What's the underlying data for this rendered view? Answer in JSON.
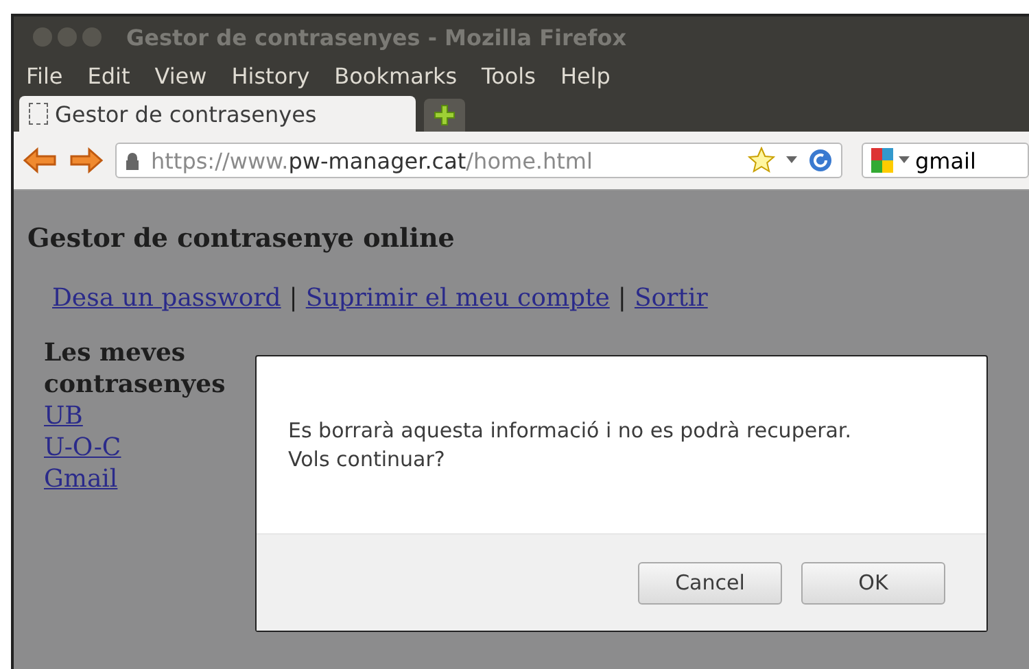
{
  "window": {
    "title": "Gestor de contrasenyes - Mozilla Firefox"
  },
  "menu": [
    "File",
    "Edit",
    "View",
    "History",
    "Bookmarks",
    "Tools",
    "Help"
  ],
  "tabs": [
    {
      "label": "Gestor de contrasenyes",
      "selected": true
    }
  ],
  "address": {
    "prefix": "https://www.",
    "host": "pw-manager.cat",
    "path": "/home.html"
  },
  "search": {
    "value": "gmail"
  },
  "page": {
    "heading": "Gestor de contrasenye online",
    "links": [
      "Desa un password",
      "Suprimir el meu compte",
      "Sortir"
    ],
    "separator": "|",
    "sidebar_title": "Les meves contrasenyes",
    "sidebar_links": [
      "UB",
      "U-O-C",
      "Gmail"
    ]
  },
  "dialog": {
    "message": "Es borrarà aquesta informació i no es podrà recuperar.",
    "question": "Vols continuar?",
    "buttons": [
      "Cancel",
      "OK"
    ]
  }
}
